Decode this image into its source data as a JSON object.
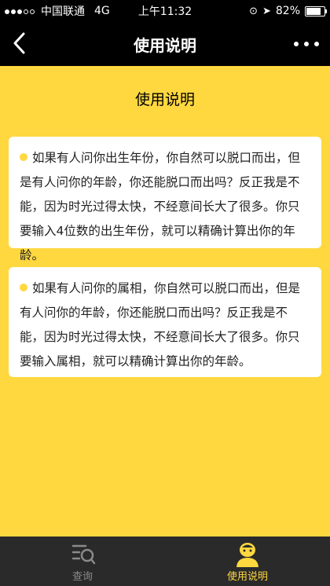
{
  "status": {
    "carrier": "中国联通",
    "network": "4G",
    "time": "上午11:32",
    "battery": "82%",
    "signal_bars_filled": 3,
    "signal_bars_total": 5
  },
  "navbar": {
    "title": "使用说明",
    "back_icon": "chevron-left-icon",
    "more_icon": "more-dots-icon"
  },
  "page": {
    "heading": "使用说明",
    "cards": [
      {
        "text": "如果有人问你出生年份，你自然可以脱口而出，但是有人问你的年龄，你还能脱口而出吗？反正我是不能，因为时光过得太快，不经意间长大了很多。你只要输入4位数的出生年份，就可以精确计算出你的年龄。"
      },
      {
        "text": "如果有人问你的属相，你自然可以脱口而出，但是有人问你的年龄，你还能脱口而出吗？反正我是不能，因为时光过得太快，不经意间长大了很多。你只要输入属相，就可以精确计算出你的年龄。"
      }
    ]
  },
  "tabbar": {
    "tabs": [
      {
        "label": "查询",
        "icon": "search-list-icon",
        "active": false
      },
      {
        "label": "使用说明",
        "icon": "user-avatar-icon",
        "active": true
      }
    ]
  },
  "colors": {
    "accent": "#FFD83F",
    "bar": "#000000",
    "tabbar": "#2a2a2a"
  }
}
